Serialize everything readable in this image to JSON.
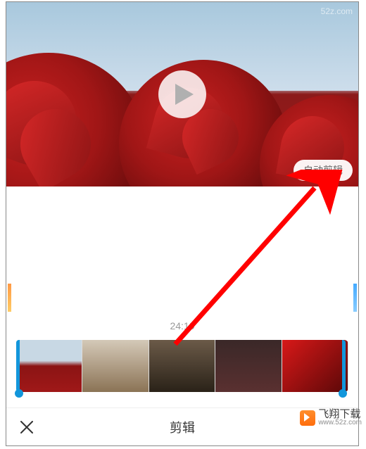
{
  "video": {
    "auto_edit_label": "自动剪辑",
    "timecode": "24:10"
  },
  "bottom": {
    "title": "剪辑"
  },
  "watermark": {
    "brand": "飞翔下载",
    "url": "www.52z.com",
    "corner": "52z.com"
  },
  "icons": {
    "play": "play-icon",
    "close": "close-icon"
  }
}
